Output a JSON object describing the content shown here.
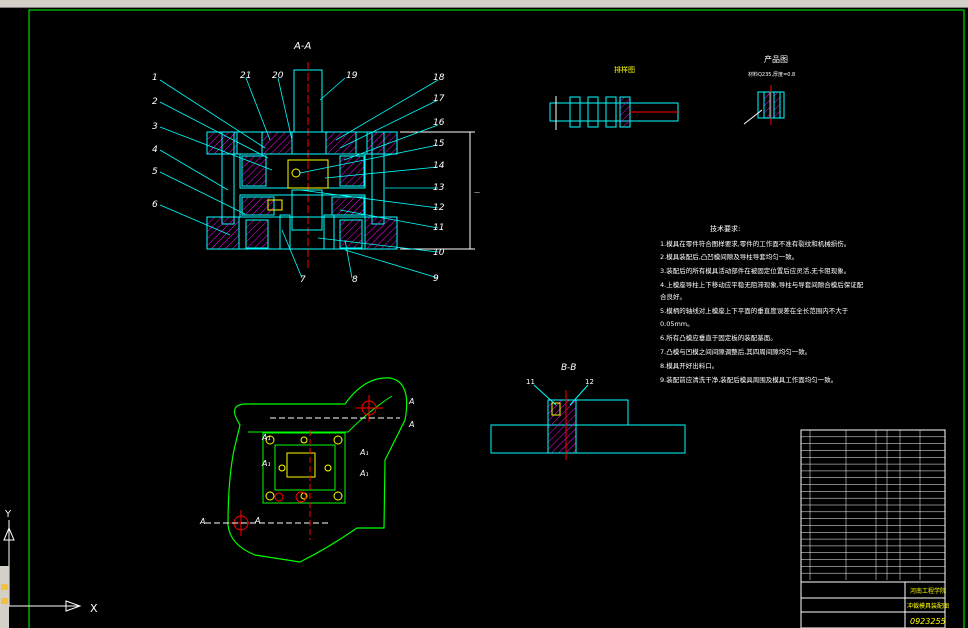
{
  "colors": {
    "background": "#000000",
    "border": "#00ff00",
    "part": "#00ffff",
    "leader": "#00ffff",
    "label": "#ffffff",
    "hatch": "#ff00ff",
    "center": "#ff0000",
    "dim": "#ffffff",
    "hole": "#ffff00",
    "text_yellow": "#ffff00",
    "plate": "#00ff00"
  },
  "section_aa": {
    "title": "A-A",
    "callouts_left": [
      "1",
      "2",
      "3",
      "4",
      "5",
      "6"
    ],
    "callouts_top": [
      "21",
      "20",
      "19",
      "18",
      "17",
      "16",
      "15",
      "14",
      "13",
      "12",
      "11",
      "10",
      "9",
      "8",
      "7"
    ]
  },
  "strip": {
    "title": "排样图"
  },
  "product": {
    "title": "产品图",
    "note": "材料Q235,厚度=0.8"
  },
  "tech_requirements": {
    "title": "技术要求:",
    "items": [
      "1.模具在零件符合图样要求,零件的工作面不准有裂纹和机械损伤。",
      "2.模具装配后,凸凹模间隙及导柱导套均匀一致。",
      "3.装配后的所有模具活动部件在被固定位置后应灵活,无卡阻现象。",
      "4.上模座导柱上下移动应平稳无阻滞现象,导柱与导套间隙合模后保证配",
      "  合良好。",
      "5.模柄的轴线对上模座上下平面的垂直度误差在全长范围内不大于",
      "  0.05mm。",
      "6.所有凸模应垂直于固定板的装配基面。",
      "7.凸模与凹模之间间隙调整后,其四周间隙均匀一致。",
      "8.模具开好出料口。",
      "9.装配前应清洗干净,装配后模具周围及模具工作面均匀一致。"
    ]
  },
  "section_bb": {
    "title": "B-B",
    "callouts": [
      "11",
      "12"
    ]
  },
  "plan_view": {
    "labels": [
      "A",
      "A",
      "A₁",
      "A₁",
      "A",
      "A",
      "A₁",
      "A₁"
    ]
  },
  "title_block": {
    "school": "河南工程学院",
    "drawing_name": "冲裁模具装配图",
    "drawing_no": "0923255",
    "rows": 22
  },
  "ucs": {
    "y_label": "Y",
    "x_label": "X"
  }
}
